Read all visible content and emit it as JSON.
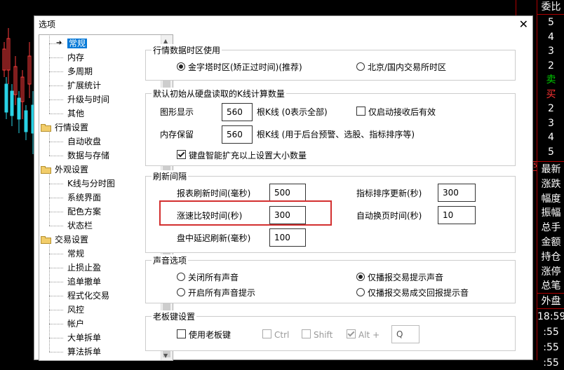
{
  "background": {
    "right_panel": {
      "header": "委比",
      "rows": [
        {
          "text": "5",
          "color": "#ffffff"
        },
        {
          "text": "4",
          "color": "#ffffff"
        },
        {
          "text": "3",
          "color": "#ffffff"
        },
        {
          "text": "2",
          "color": "#ffffff"
        },
        {
          "text": "卖",
          "color": "#00cc00"
        },
        {
          "text": "买",
          "color": "#ff3333"
        },
        {
          "text": "2",
          "color": "#ffffff"
        },
        {
          "text": "3",
          "color": "#ffffff"
        },
        {
          "text": "4",
          "color": "#ffffff"
        },
        {
          "text": "5",
          "color": "#ffffff"
        }
      ],
      "labels": [
        "最新",
        "涨跌",
        "幅度",
        "振幅",
        "总手",
        "金额",
        "持仓",
        "涨停",
        "总笔"
      ],
      "outer": "外盘",
      "times": [
        "18:59",
        ":55",
        ":55",
        ":55"
      ],
      "marker": "5"
    }
  },
  "dialog": {
    "title": "选项",
    "close_glyph": "✕",
    "tree": {
      "items": [
        {
          "label": "常规",
          "type": "leaf",
          "selected": true,
          "arrow": true
        },
        {
          "label": "内存",
          "type": "leaf"
        },
        {
          "label": "多周期",
          "type": "leaf"
        },
        {
          "label": "扩展统计",
          "type": "leaf"
        },
        {
          "label": "升级与时间",
          "type": "leaf"
        },
        {
          "label": "其他",
          "type": "leaf"
        },
        {
          "label": "行情设置",
          "type": "folder"
        },
        {
          "label": "自动收盘",
          "type": "leaf"
        },
        {
          "label": "数据与存储",
          "type": "leaf"
        },
        {
          "label": "外观设置",
          "type": "folder"
        },
        {
          "label": "K线与分时图",
          "type": "leaf"
        },
        {
          "label": "系统界面",
          "type": "leaf"
        },
        {
          "label": "配色方案",
          "type": "leaf"
        },
        {
          "label": "状态栏",
          "type": "leaf"
        },
        {
          "label": "交易设置",
          "type": "folder"
        },
        {
          "label": "常规",
          "type": "leaf"
        },
        {
          "label": "止损止盈",
          "type": "leaf"
        },
        {
          "label": "追单撤单",
          "type": "leaf"
        },
        {
          "label": "程式化交易",
          "type": "leaf"
        },
        {
          "label": "风控",
          "type": "leaf"
        },
        {
          "label": "帐户",
          "type": "leaf"
        },
        {
          "label": "大单拆单",
          "type": "leaf"
        },
        {
          "label": "算法拆单",
          "type": "leaf"
        }
      ]
    },
    "timezone": {
      "title": "行情数据时区使用",
      "opt1": "金字塔时区(矫正过时间)(推荐)",
      "opt2": "北京/国内交易所时区"
    },
    "kline": {
      "title": "默认初始从硬盘读取的K线计算数量",
      "chart_label": "图形显示",
      "chart_value": "560",
      "chart_suffix": "根K线 (0表示全部)",
      "only_after_start": "仅启动接收后有效",
      "memory_label": "内存保留",
      "memory_value": "560",
      "memory_suffix": "根K线 (用于后台预警、选股、指标排序等)",
      "smart_expand": "键盘智能扩充以上设置大小数量"
    },
    "refresh": {
      "title": "刷新间隔",
      "report_label": "报表刷新时间(毫秒)",
      "report_value": "500",
      "indicator_label": "指标排序更新(秒)",
      "indicator_value": "300",
      "speed_label": "涨速比较时间(秒)",
      "speed_value": "300",
      "autopage_label": "自动换页时间(秒)",
      "autopage_value": "10",
      "delay_label": "盘中延迟刷新(毫秒)",
      "delay_value": "100"
    },
    "sound": {
      "title": "声音选项",
      "off_all": "关闭所有声音",
      "trade_only": "仅播报交易提示声音",
      "on_all": "开启所有声音提示",
      "trade_fill": "仅播报交易成交回报提示音"
    },
    "boss": {
      "title": "老板键设置",
      "use": "使用老板键",
      "ctrl": "Ctrl",
      "shift": "Shift",
      "alt": "Alt +",
      "key": "Q"
    }
  }
}
